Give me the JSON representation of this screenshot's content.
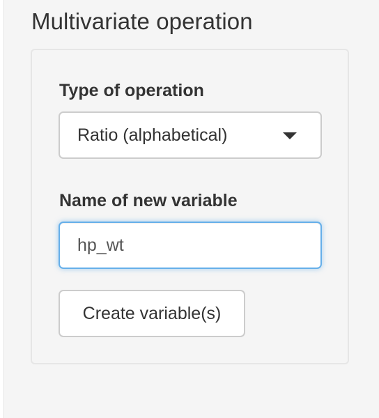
{
  "section": {
    "title": "Multivariate operation"
  },
  "operation": {
    "label": "Type of operation",
    "selected": "Ratio (alphabetical)"
  },
  "new_variable": {
    "label": "Name of new variable",
    "value": "hp_wt"
  },
  "create_button": {
    "label": "Create variable(s)"
  },
  "colors": {
    "panel_bg": "#f5f5f5",
    "focus_border": "#66afe9",
    "text": "#333333"
  },
  "icons": {
    "select_caret": "caret-down-icon"
  }
}
